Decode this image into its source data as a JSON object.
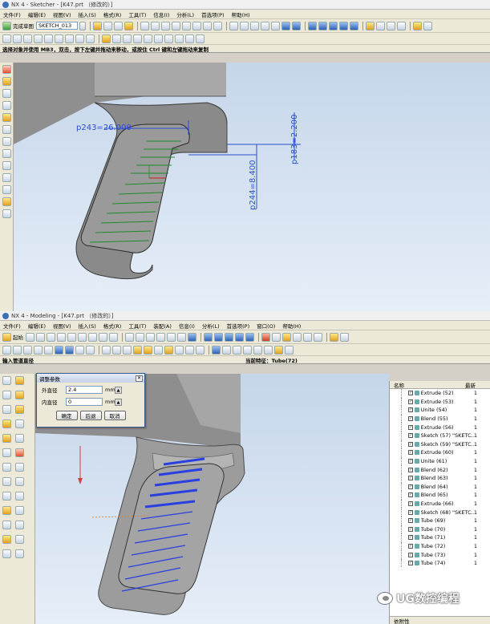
{
  "sketcher": {
    "title": "NX 4 - Sketcher - [K47.prt （修改的）]",
    "menu": [
      "文件(F)",
      "编辑(E)",
      "视图(V)",
      "插入(S)",
      "格式(R)",
      "工具(T)",
      "信息(I)",
      "分析(L)",
      "首选项(P)",
      "帮助(H)"
    ],
    "finish_label": "完成草图",
    "sketch_name": "SKETCH_013",
    "status": "选择对象并使用 MB3，双击，按下左键并拖动来移动，或按住 Ctrl 键和左键拖动来复制",
    "dimensions": {
      "d243": "p243=26.000",
      "d244": "p244=8.400",
      "d_vert": "p183=2.200"
    }
  },
  "modeling": {
    "title": "NX 4 - Modeling - [K47.prt （修改的）]",
    "menu": [
      "文件(F)",
      "编辑(E)",
      "视图(V)",
      "插入(S)",
      "格式(R)",
      "工具(T)",
      "装配(A)",
      "信息(I)",
      "分析(L)",
      "首选项(P)",
      "窗口(O)",
      "帮助(H)"
    ],
    "start_label": "起始",
    "status_left": "输入管道直径",
    "status_right": "当前特征：Tube(72)",
    "dialog": {
      "title": "调整参数",
      "outer_label": "外直径",
      "outer_value": "2.4",
      "inner_label": "内直径",
      "inner_value": "0",
      "unit": "mm",
      "ok": "确定",
      "back": "后退",
      "cancel": "取消"
    },
    "navigator": {
      "col_name": "名称",
      "col_update": "最新",
      "footer": "依附性",
      "rows": [
        {
          "name": "Extrude (52)",
          "up": "1"
        },
        {
          "name": "Extrude (53)",
          "up": "1"
        },
        {
          "name": "Unite (54)",
          "up": "1"
        },
        {
          "name": "Blend (55)",
          "up": "1"
        },
        {
          "name": "Extrude (56)",
          "up": "1"
        },
        {
          "name": "Sketch (57) \"SKETC...",
          "up": "1"
        },
        {
          "name": "Sketch (59) \"SKETC...",
          "up": "1"
        },
        {
          "name": "Extrude (60)",
          "up": "1"
        },
        {
          "name": "Unite (61)",
          "up": "1"
        },
        {
          "name": "Blend (62)",
          "up": "1"
        },
        {
          "name": "Blend (63)",
          "up": "1"
        },
        {
          "name": "Blend (64)",
          "up": "1"
        },
        {
          "name": "Blend (65)",
          "up": "1"
        },
        {
          "name": "Extrude (66)",
          "up": "1"
        },
        {
          "name": "Sketch (68) \"SKETC...",
          "up": "1"
        },
        {
          "name": "Tube (69)",
          "up": "1"
        },
        {
          "name": "Tube (70)",
          "up": "1"
        },
        {
          "name": "Tube (71)",
          "up": "1"
        },
        {
          "name": "Tube (72)",
          "up": "1"
        },
        {
          "name": "Tube (73)",
          "up": "1"
        },
        {
          "name": "Tube (74)",
          "up": "1"
        }
      ]
    }
  },
  "watermark": "UG数控编程",
  "colors": {
    "viewport_top": "#c5d6ea",
    "viewport_bottom": "#e6eef8",
    "body_gray": "#8c8c8c",
    "dim_blue": "#2a4fd0",
    "groove_green": "#1f8a2a",
    "groove_blue": "#2a3fe0"
  }
}
